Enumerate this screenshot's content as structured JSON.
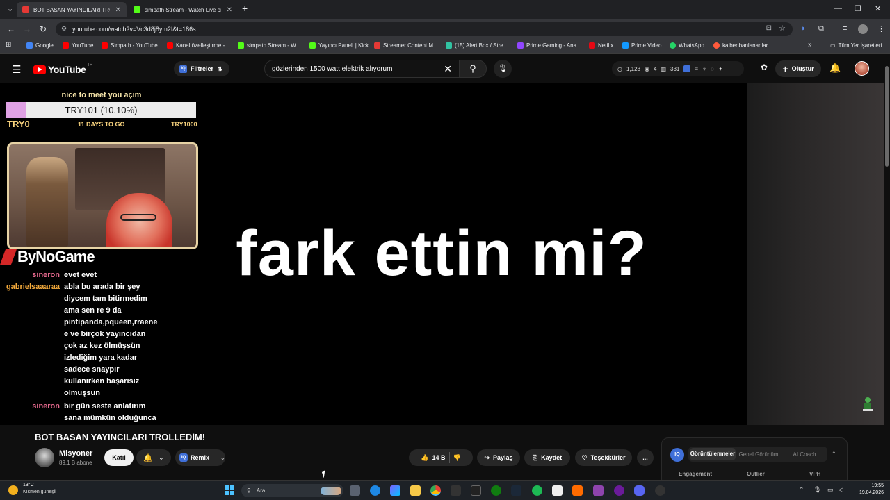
{
  "browser": {
    "tabs": [
      {
        "title": "BOT BASAN YAYINCILARI TROLLI",
        "color": "#e53935",
        "active": true
      },
      {
        "title": "simpath Stream - Watch Live on",
        "color": "#53fc18",
        "active": false
      }
    ],
    "url": "youtube.com/watch?v=Vc3d8j8ym2I&t=186s",
    "bookmarks": [
      {
        "label": "Google",
        "color": "#4285f4"
      },
      {
        "label": "YouTube",
        "color": "#ff0000"
      },
      {
        "label": "Simpath - YouTube",
        "color": "#ff0000"
      },
      {
        "label": "Kanal özelleştirme -...",
        "color": "#ff0000"
      },
      {
        "label": "simpath Stream - W...",
        "color": "#53fc18"
      },
      {
        "label": "Yayıncı Paneli | Kick",
        "color": "#53fc18"
      },
      {
        "label": "Streamer Content M...",
        "color": "#e53935"
      },
      {
        "label": "(15) Alert Box / Stre...",
        "color": "#31c3a2"
      },
      {
        "label": "Prime Gaming - Ana...",
        "color": "#9146ff"
      },
      {
        "label": "Netflix",
        "color": "#e50914"
      },
      {
        "label": "Prime Video",
        "color": "#1399ff"
      },
      {
        "label": "WhatsApp",
        "color": "#25d366"
      },
      {
        "label": "kalbenbanlananlar",
        "color": "#ff5a3c"
      }
    ],
    "bookmarks_more": "»",
    "all_bookmarks": "Tüm Yer İşaretleri"
  },
  "youtube": {
    "logo_text": "YouTube",
    "country": "TR",
    "filters_label": "Filtreler",
    "search_value": "gözlerinden 1500 watt elektrik alıyorum",
    "stats": {
      "views": "1,123",
      "eye": "4",
      "count": "331"
    },
    "create_label": "Oluştur"
  },
  "overlay": {
    "goal_message": "nice to meet you açım",
    "goal_amount": "TRY101 (10.10%)",
    "goal_progress": 0.101,
    "goal_start": "TRY0",
    "goal_days": "11 DAYS TO GO",
    "goal_end": "TRY1000",
    "channel_name": "ByNoGame",
    "chat": [
      {
        "user": "sineron",
        "user_color": "#e86a8f",
        "lines": [
          "evet evet"
        ]
      },
      {
        "user": "gabrielsaaaraa",
        "user_color": "#f2a93b",
        "lines": [
          "abla bu arada bir şey",
          "diycem tam bitirmedim",
          "ama sen re 9 da",
          "pintipanda,pqueen,rraene",
          "e ve birçok yayıncıdan",
          "çok az kez ölmüşsün",
          "izlediğim yara kadar",
          "sadece snaypır",
          "kullanırken başarısız",
          "olmuşsun"
        ]
      },
      {
        "user": "sineron",
        "user_color": "#e86a8f",
        "lines": [
          "bir gün seste anlatırım",
          "sana mümkün olduğunca"
        ]
      }
    ],
    "big_caption": "fark ettin mi?"
  },
  "video_info": {
    "title": "BOT BASAN YAYINCILARI TROLLEDİM!",
    "channel": "Misyoner",
    "subscribers": "89,1 B abone",
    "join_label": "Katıl",
    "remix_label": "Remix",
    "likes": "14 B",
    "share_label": "Paylaş",
    "save_label": "Kaydet",
    "thanks_label": "Teşekkürler",
    "more_label": "..."
  },
  "analytics_panel": {
    "badge": "IQ",
    "tabs": [
      "Görüntülenmeler",
      "Genel Görünüm",
      "AI Coach"
    ],
    "columns": [
      "Engagement",
      "Outlier",
      "VPH"
    ]
  },
  "taskbar": {
    "temperature": "13°C",
    "weather": "Kısmen güneşli",
    "search_placeholder": "Ara",
    "time": "19:55",
    "date": "19.04.2026"
  }
}
